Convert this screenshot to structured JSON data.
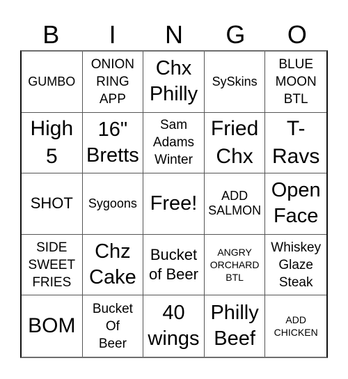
{
  "card": {
    "header": [
      "B",
      "I",
      "N",
      "G",
      "O"
    ],
    "cells": [
      [
        {
          "text": "GUMBO",
          "size": "s-sm"
        },
        {
          "text": "ONION\nRING\nAPP",
          "size": "s-sm2"
        },
        {
          "text": "Chx\nPhilly",
          "size": "s-lg"
        },
        {
          "text": "SySkins",
          "size": "s-sm"
        },
        {
          "text": "BLUE\nMOON\nBTL",
          "size": "s-sm2"
        }
      ],
      [
        {
          "text": "High\n5",
          "size": "s-xl"
        },
        {
          "text": "16\"\nBretts",
          "size": "s-lg"
        },
        {
          "text": "Sam\nAdams\nWinter",
          "size": "s-sm2"
        },
        {
          "text": "Fried\nChx",
          "size": "s-xl"
        },
        {
          "text": "T-\nRavs",
          "size": "s-xl"
        }
      ],
      [
        {
          "text": "SHOT",
          "size": "s-md"
        },
        {
          "text": "Sygoons",
          "size": "s-sm"
        },
        {
          "text": "Free!",
          "size": "s-lg"
        },
        {
          "text": "ADD\nSALMON",
          "size": "s-sm"
        },
        {
          "text": "Open\nFace",
          "size": "s-lg"
        }
      ],
      [
        {
          "text": "SIDE\nSWEET\nFRIES",
          "size": "s-sm2"
        },
        {
          "text": "Chz\nCake",
          "size": "s-lg"
        },
        {
          "text": "Bucket\nof Beer",
          "size": "s-md"
        },
        {
          "text": "ANGRY\nORCHARD\nBTL",
          "size": "s-xs"
        },
        {
          "text": "Whiskey\nGlaze\nSteak",
          "size": "s-sm2"
        }
      ],
      [
        {
          "text": "BOM",
          "size": "s-xl"
        },
        {
          "text": "Bucket\nOf\nBeer",
          "size": "s-sm2"
        },
        {
          "text": "40\nwings",
          "size": "s-lg"
        },
        {
          "text": "Philly\nBeef",
          "size": "s-lg"
        },
        {
          "text": "ADD\nCHICKEN",
          "size": "s-xs"
        }
      ]
    ]
  }
}
